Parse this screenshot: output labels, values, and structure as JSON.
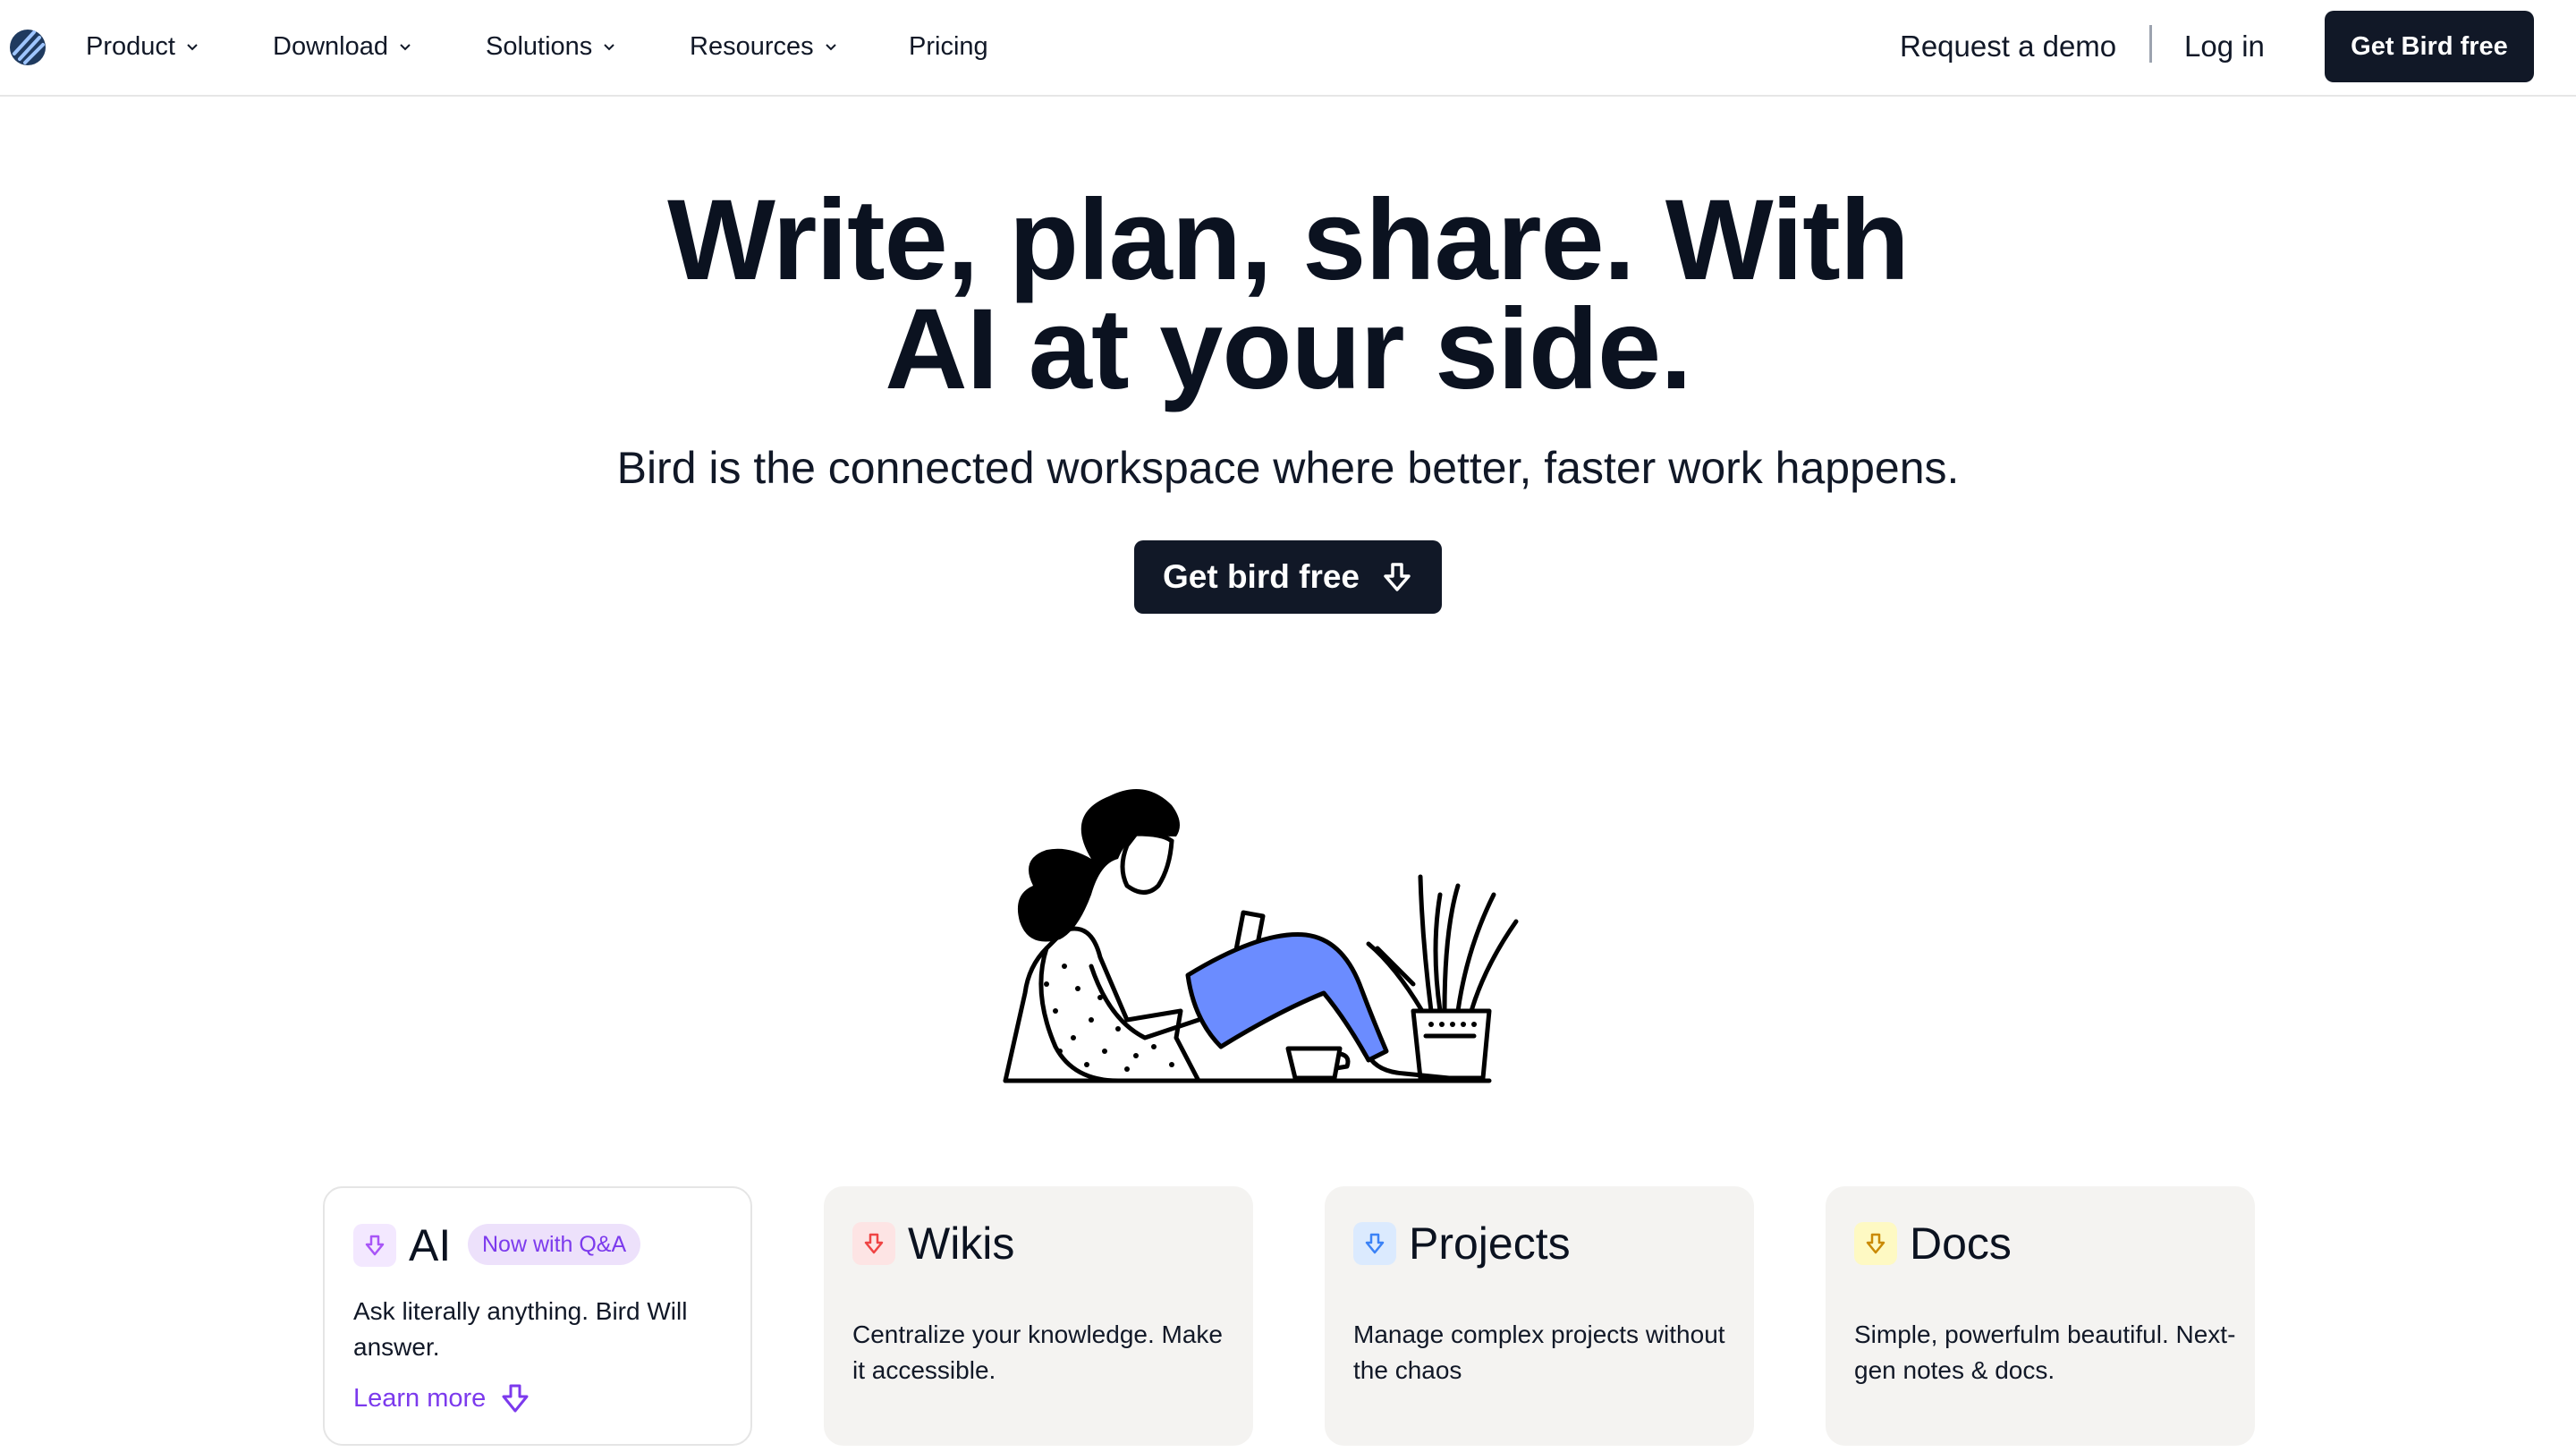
{
  "nav": {
    "logo_icon": "bird-logo-icon",
    "items": [
      {
        "label": "Product",
        "has_dropdown": true
      },
      {
        "label": "Download",
        "has_dropdown": true
      },
      {
        "label": "Solutions",
        "has_dropdown": true
      },
      {
        "label": "Resources",
        "has_dropdown": true
      },
      {
        "label": "Pricing",
        "has_dropdown": false
      }
    ],
    "request_demo": "Request a demo",
    "login": "Log in",
    "cta": "Get Bird free"
  },
  "hero": {
    "title_line1": "Write, plan, share. With",
    "title_line2": "AI at your side.",
    "subtitle": "Bird is the connected workspace where better, faster work happens.",
    "cta": "Get bird free",
    "cta_icon": "arrow-down-icon"
  },
  "cards": [
    {
      "title": "AI",
      "badge": "Now with Q&A",
      "description": "Ask literally anything. Bird Will answer.",
      "link": "Learn more",
      "icon_color": "#a855f7",
      "icon_bg": "#f3e8ff"
    },
    {
      "title": "Wikis",
      "description": "Centralize your knowledge. Make it accessible.",
      "icon_color": "#ef4444",
      "icon_bg": "#fde4e4"
    },
    {
      "title": "Projects",
      "description": "Manage complex projects without the chaos",
      "icon_color": "#3b82f6",
      "icon_bg": "#dbeafe"
    },
    {
      "title": "Docs",
      "description": "Simple, powerfulm beautiful. Next-gen notes & docs.",
      "icon_color": "#ca8a04",
      "icon_bg": "#fef9c3"
    }
  ],
  "colors": {
    "dark": "#111827",
    "accent_purple": "#7c3aed",
    "illustration_blue": "#6b8cff"
  }
}
